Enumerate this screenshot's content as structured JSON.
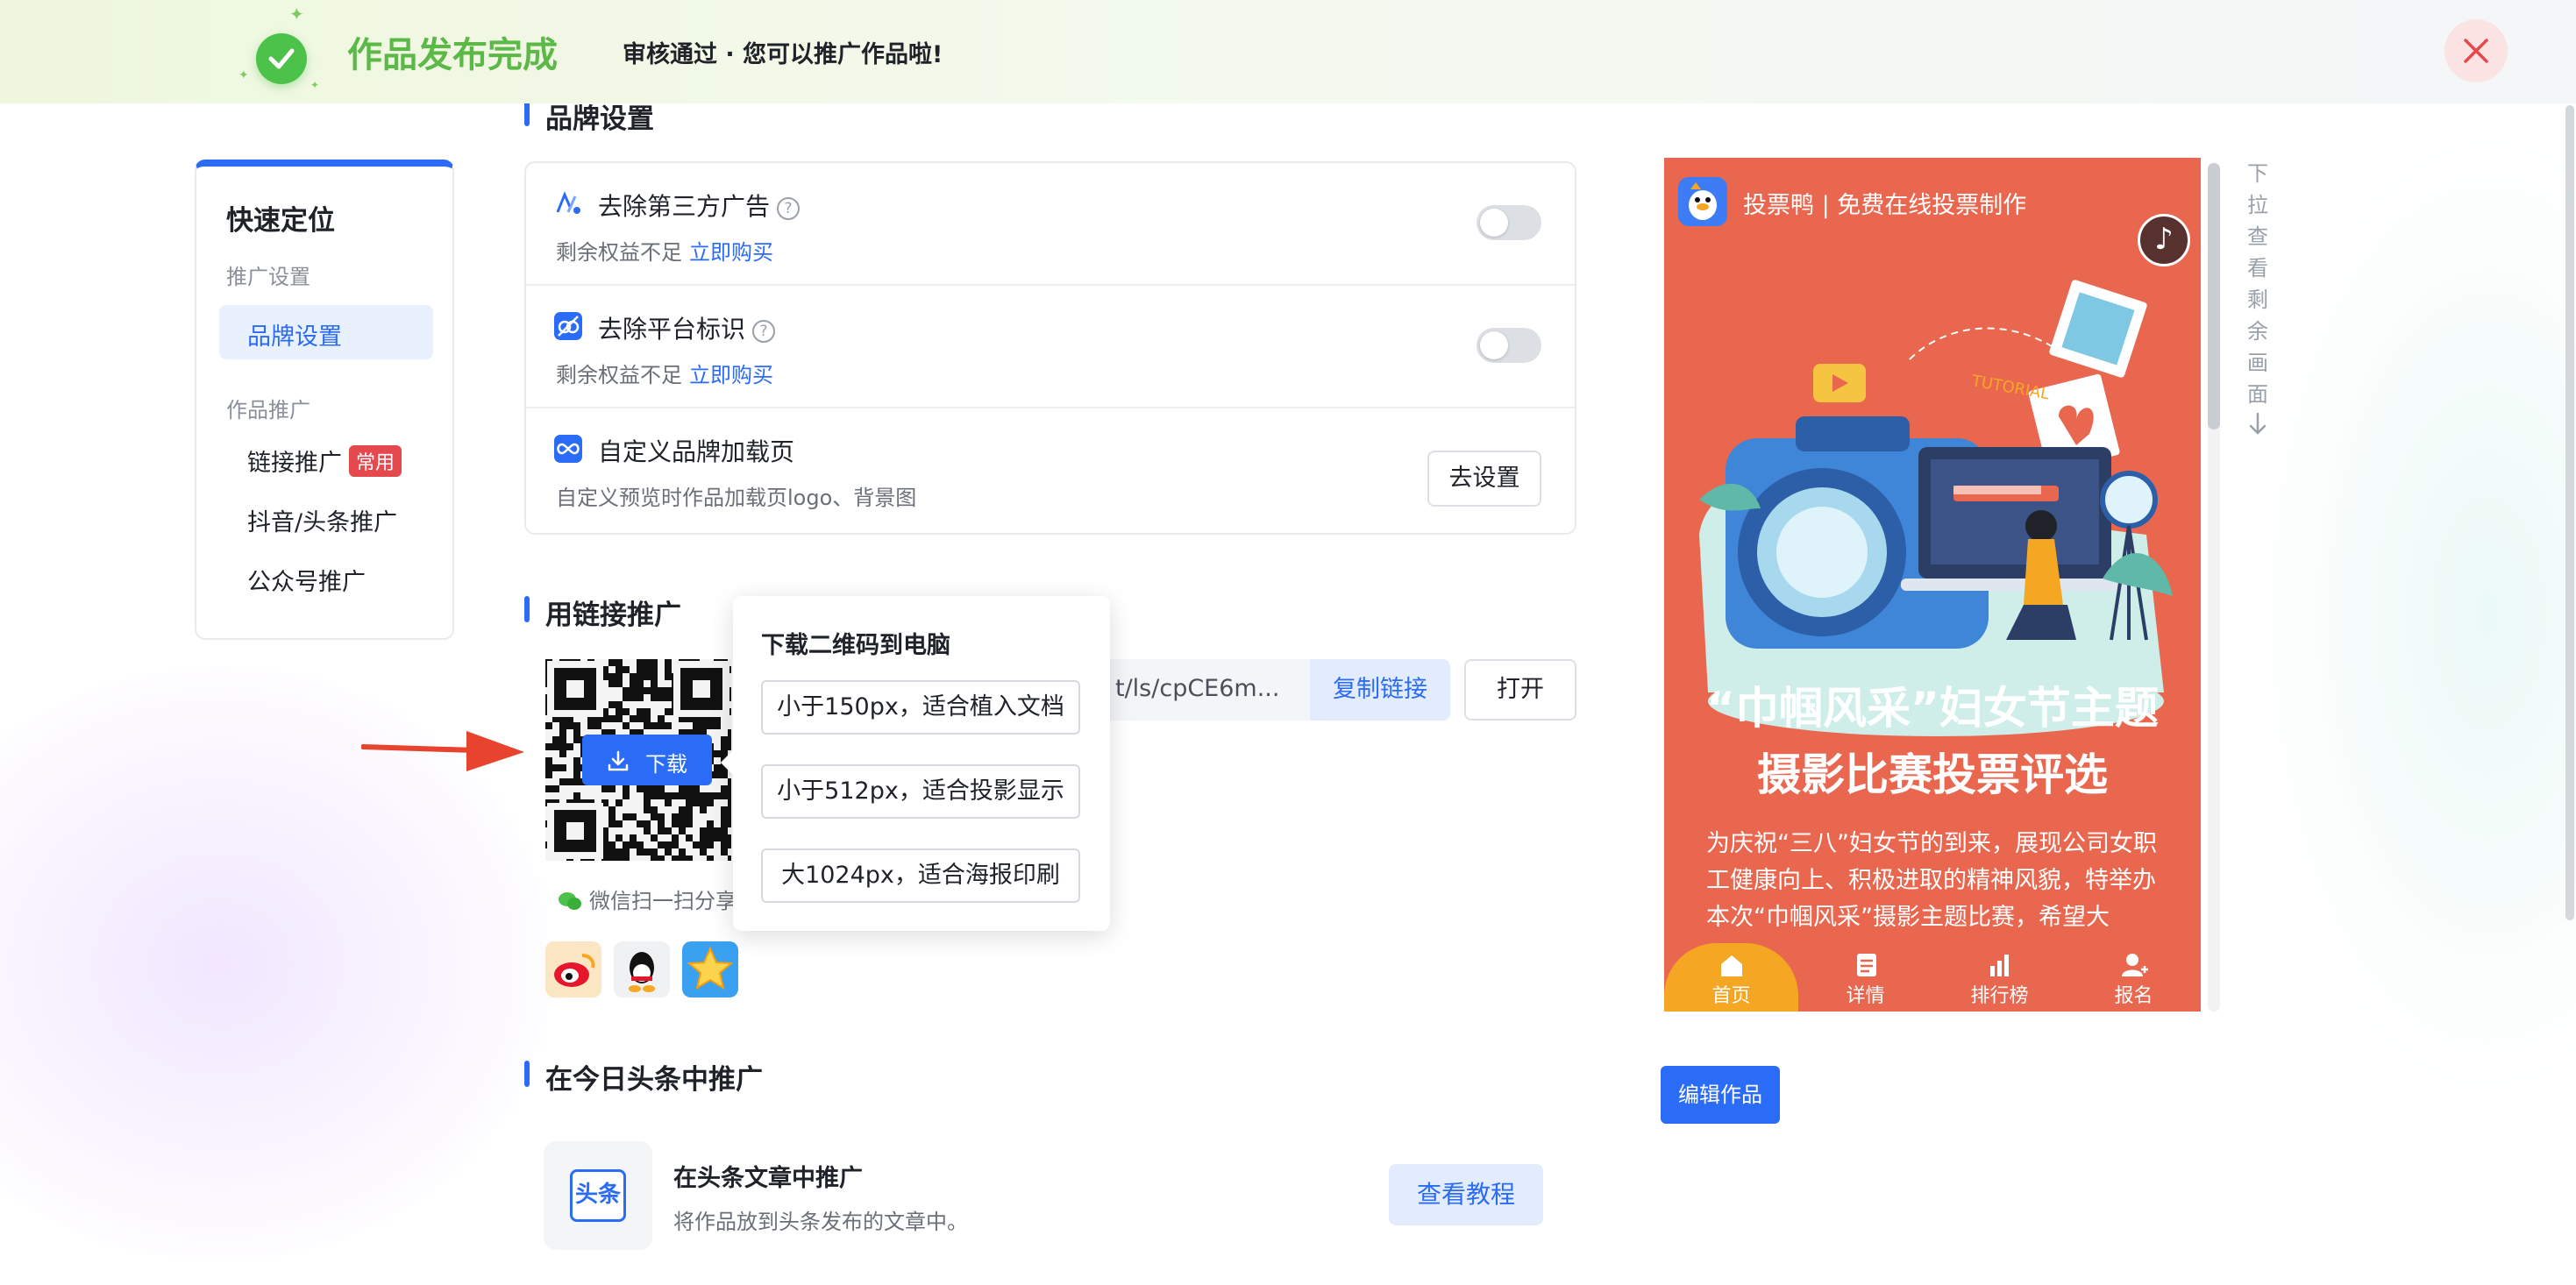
{
  "banner": {
    "title": "作品发布完成",
    "subtitle": "审核通过 · 您可以推广作品啦!"
  },
  "sidebar": {
    "title": "快速定位",
    "group_promo": "推广设置",
    "item_brand": "品牌设置",
    "group_work": "作品推广",
    "item_link": "链接推广",
    "badge_common": "常用",
    "item_douyin": "抖音/头条推广",
    "item_wechat": "公众号推广"
  },
  "brand": {
    "section_title": "品牌设置",
    "rows": [
      {
        "title": "去除第三方广告",
        "desc": "剩余权益不足",
        "link": "立即购买"
      },
      {
        "title": "去除平台标识",
        "desc": "剩余权益不足",
        "link": "立即购买"
      },
      {
        "title": "自定义品牌加载页",
        "desc": "自定义预览时作品加载页logo、背景图",
        "button": "去设置"
      }
    ]
  },
  "link_promo": {
    "section_title": "用链接推广",
    "download_label": "下载",
    "wechat_hint": "微信扫一扫分享",
    "link_text": "t/ls/cpCE6m...",
    "copy_label": "复制链接",
    "open_label": "打开"
  },
  "popover": {
    "title": "下载二维码到电脑",
    "options": [
      "小于150px，适合植入文档",
      "小于512px，适合投影显示",
      "大1024px，适合海报印刷"
    ]
  },
  "toutiao": {
    "section_title": "在今日头条中推广",
    "icon_text": "头条",
    "card_title": "在头条文章中推广",
    "card_desc": "将作品放到头条发布的文章中。",
    "tutorial_label": "查看教程"
  },
  "preview": {
    "brand": "投票鸭 | 免费在线投票制作",
    "headline_1": "“巾帼风采”妇女节主题",
    "headline_2": "摄影比赛投票评选",
    "body": "为庆祝“三八”妇女节的到来，展现公司女职工健康向上、积极进取的精神风貌，特举办本次“巾帼风采”摄影主题比赛，希望大",
    "tabs": [
      "首页",
      "详情",
      "排行榜",
      "报名"
    ],
    "scroll_hint": "下拉查看剩余画面",
    "edit_label": "编辑作品",
    "illus_tag": "TUTORIAL"
  },
  "colors": {
    "accent": "#2b6cf6",
    "success": "#4cc24a",
    "phone_bg": "#e9674f",
    "badge_red": "#e5484d"
  }
}
